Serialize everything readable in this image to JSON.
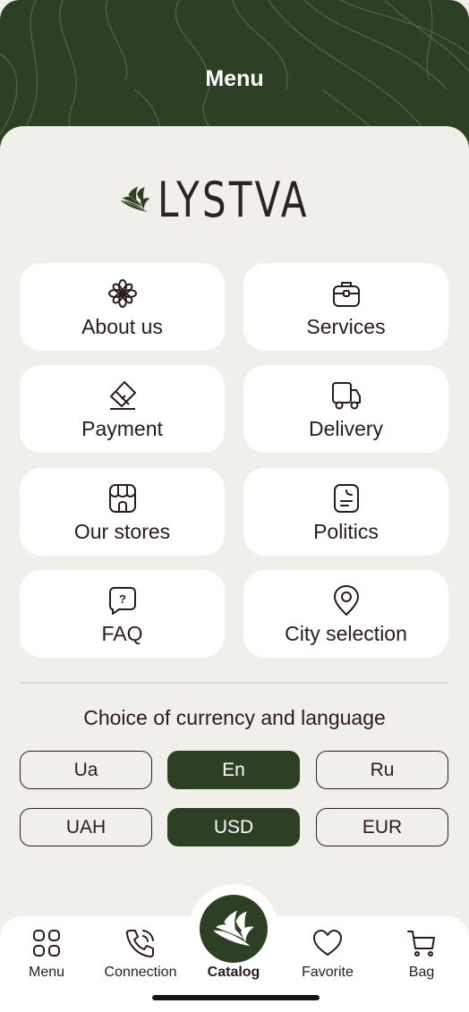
{
  "header": {
    "title": "Menu"
  },
  "brand": {
    "name": "LYSTVA"
  },
  "menu_tiles": [
    {
      "label": "About us",
      "icon": "flower-icon"
    },
    {
      "label": "Services",
      "icon": "briefcase-icon"
    },
    {
      "label": "Payment",
      "icon": "card-icon"
    },
    {
      "label": "Delivery",
      "icon": "truck-icon"
    },
    {
      "label": "Our stores",
      "icon": "store-icon"
    },
    {
      "label": "Politics",
      "icon": "document-icon"
    },
    {
      "label": "FAQ",
      "icon": "question-bubble-icon"
    },
    {
      "label": "City selection",
      "icon": "location-pin-icon"
    }
  ],
  "choice": {
    "title": "Choice of currency and language",
    "languages": [
      {
        "label": "Ua",
        "selected": false
      },
      {
        "label": "En",
        "selected": true
      },
      {
        "label": "Ru",
        "selected": false
      }
    ],
    "currencies": [
      {
        "label": "UAH",
        "selected": false
      },
      {
        "label": "USD",
        "selected": true
      },
      {
        "label": "EUR",
        "selected": false
      }
    ]
  },
  "tabbar": {
    "menu": "Menu",
    "connection": "Connection",
    "catalog": "Catalog",
    "favorite": "Favorite",
    "bag": "Bag"
  },
  "colors": {
    "brand_green": "#2d4024",
    "background": "#f1efea",
    "text": "#2b1b1c"
  }
}
